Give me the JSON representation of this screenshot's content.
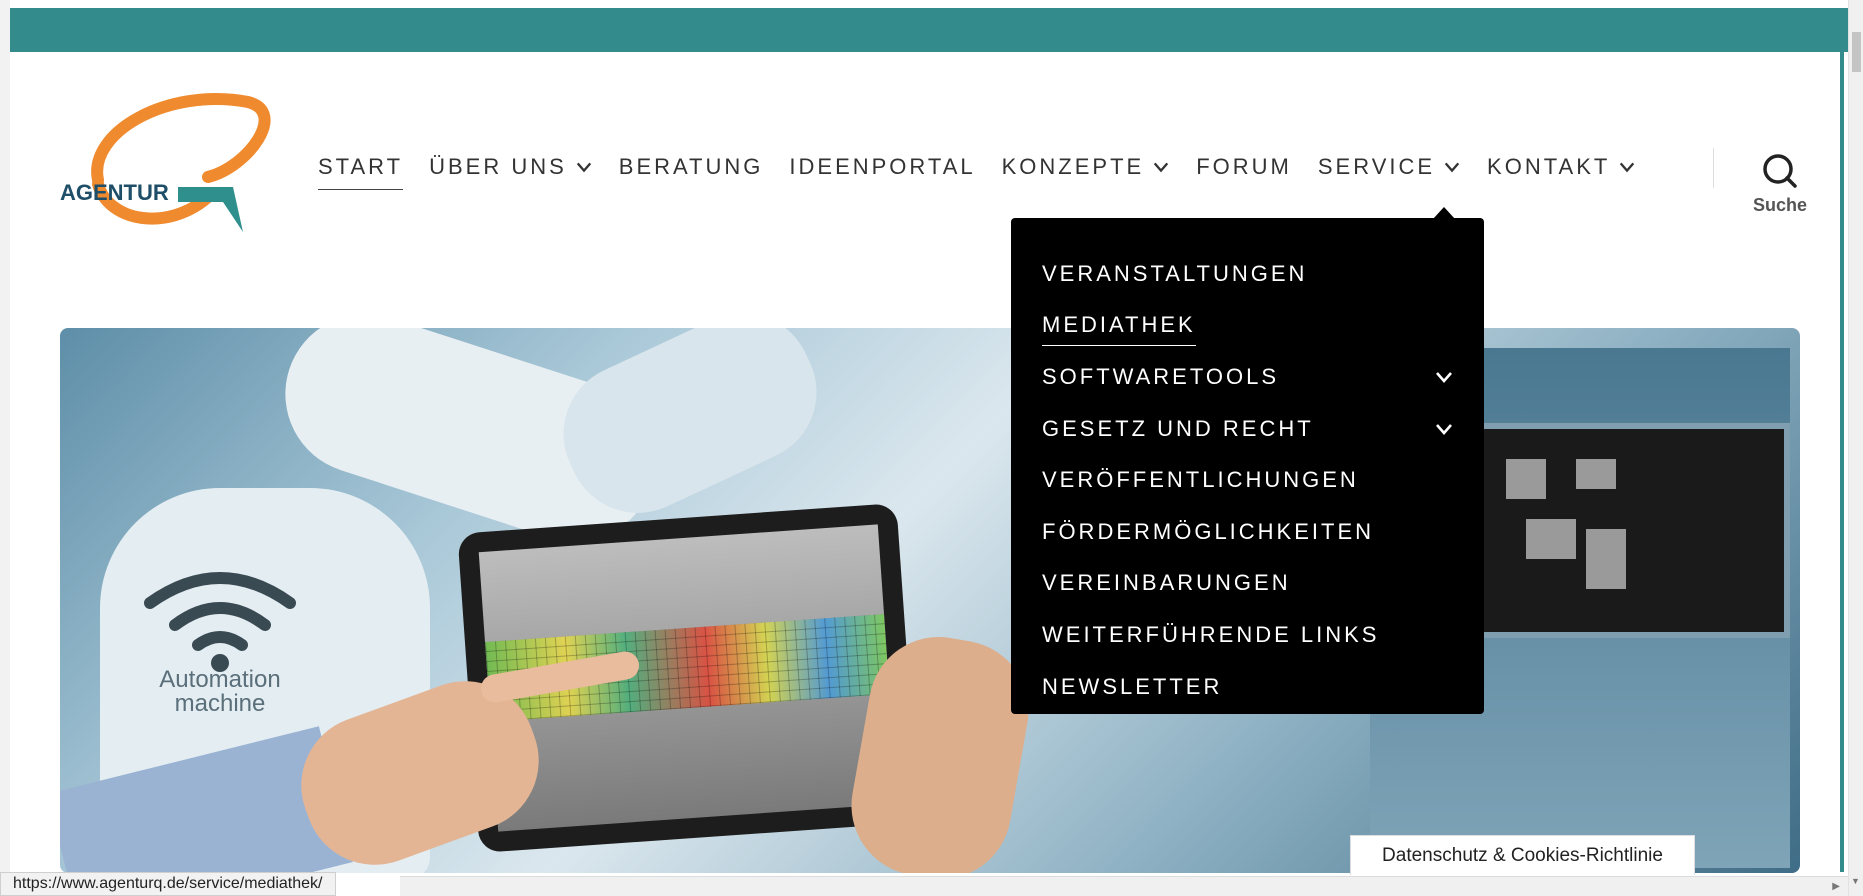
{
  "colors": {
    "topbar": "#338c8b",
    "logo_orange": "#ef8a2e",
    "logo_teal": "#2f8f8c",
    "dropdown_bg": "#000000",
    "nav_text": "#333333"
  },
  "logo": {
    "text": "AGENTUR"
  },
  "nav": {
    "items": [
      {
        "label": "START",
        "has_submenu": false,
        "current": true
      },
      {
        "label": "ÜBER UNS",
        "has_submenu": true
      },
      {
        "label": "BERATUNG",
        "has_submenu": false
      },
      {
        "label": "IDEENPORTAL",
        "has_submenu": false
      },
      {
        "label": "KONZEPTE",
        "has_submenu": true
      },
      {
        "label": "FORUM",
        "has_submenu": false
      },
      {
        "label": "SERVICE",
        "has_submenu": true,
        "expanded": true
      },
      {
        "label": "KONTAKT",
        "has_submenu": true
      }
    ],
    "search_label": "Suche",
    "search_icon": "search-icon"
  },
  "hero": {
    "overlay_text_line1": "Automation",
    "overlay_text_line2": "machine"
  },
  "service_menu": {
    "items": [
      {
        "label": "VERANSTALTUNGEN",
        "has_submenu": false
      },
      {
        "label": "MEDIATHEK",
        "has_submenu": false,
        "hovered": true
      },
      {
        "label": "SOFTWARETOOLS",
        "has_submenu": true
      },
      {
        "label": "GESETZ UND RECHT",
        "has_submenu": true
      },
      {
        "label": "VERÖFFENTLICHUNGEN",
        "has_submenu": false
      },
      {
        "label": "FÖRDERMÖGLICHKEITEN",
        "has_submenu": false
      },
      {
        "label": "VEREINBARUNGEN",
        "has_submenu": false
      },
      {
        "label": "WEITERFÜHRENDE LINKS",
        "has_submenu": false
      },
      {
        "label": "NEWSLETTER",
        "has_submenu": false
      }
    ]
  },
  "cookie_notice": {
    "label": "Datenschutz & Cookies-Richtlinie"
  },
  "status_bar": {
    "url": "https://www.agenturq.de/service/mediathek/"
  }
}
